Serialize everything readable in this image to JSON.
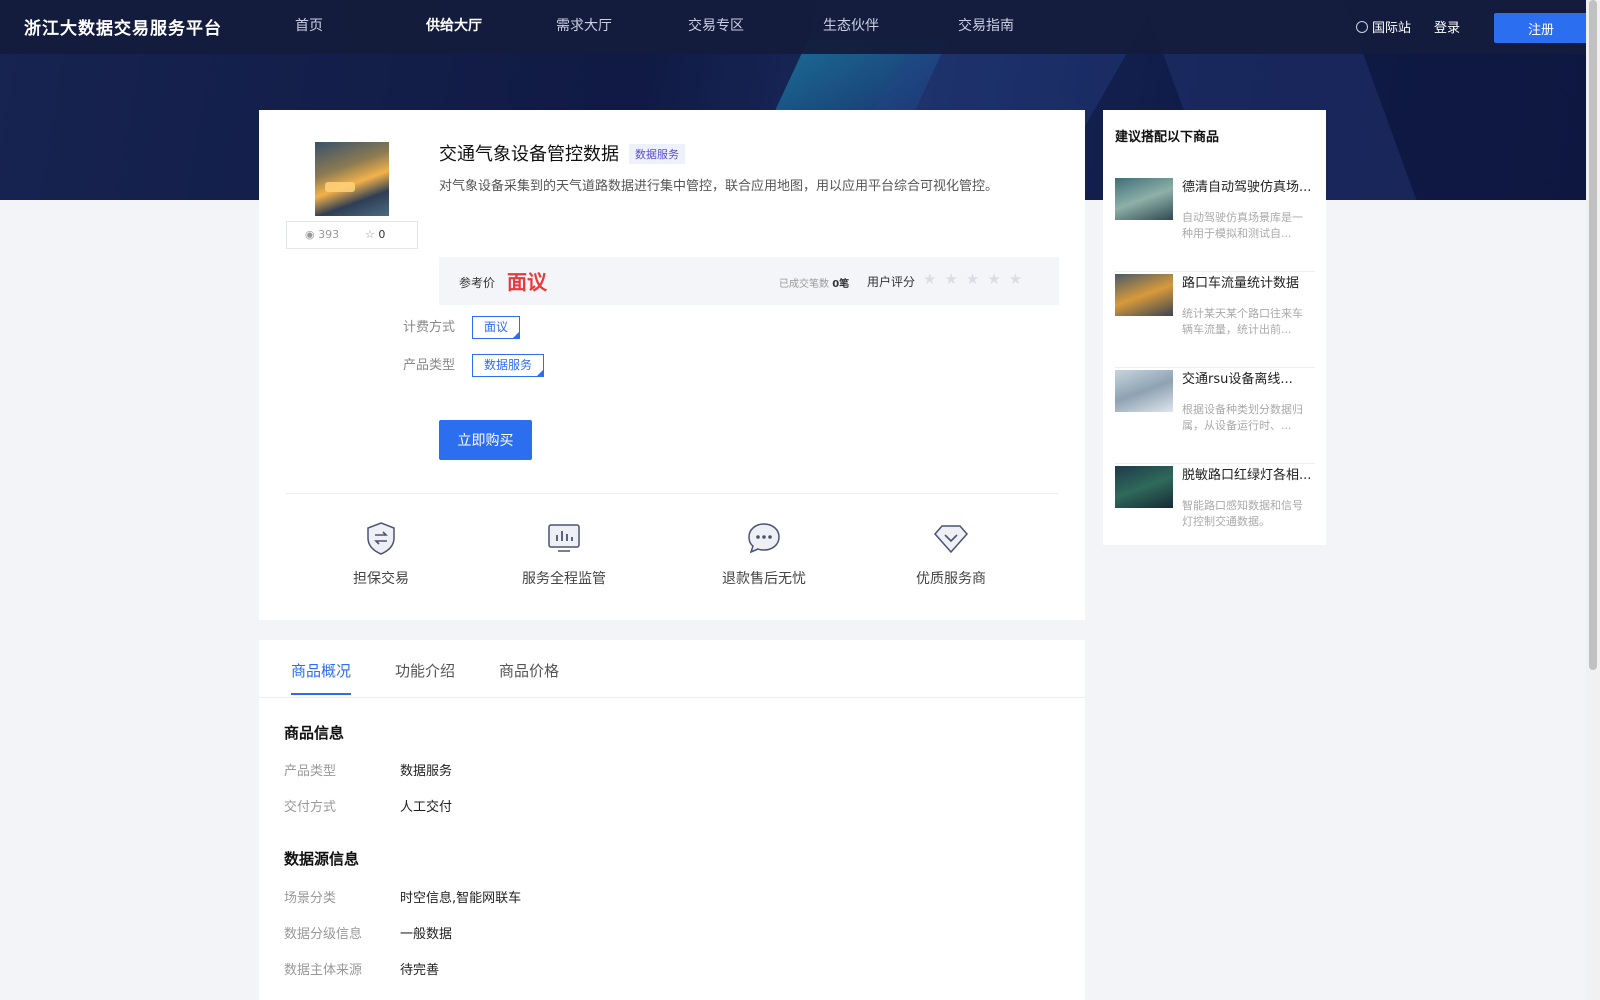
{
  "header": {
    "logo": "浙江大数据交易服务平台",
    "nav": [
      {
        "label": "首页",
        "active": false
      },
      {
        "label": "供给大厅",
        "active": true
      },
      {
        "label": "需求大厅",
        "active": false
      },
      {
        "label": "交易专区",
        "active": false
      },
      {
        "label": "生态伙伴",
        "active": false
      },
      {
        "label": "交易指南",
        "active": false
      }
    ],
    "intl_label": "国际站",
    "login_label": "登录",
    "register_label": "注册"
  },
  "product": {
    "title": "交通气象设备管控数据",
    "tag": "数据服务",
    "description": "对气象设备采集到的天气道路数据进行集中管控，联合应用地图，用以应用平台综合可视化管控。",
    "views": "393",
    "favorites": "0",
    "price_label": "参考价",
    "price": "面议",
    "deals_label": "已成交笔数",
    "deals_value": "0笔",
    "rating_label": "用户评分",
    "rating": 0,
    "billing_label": "计费方式",
    "billing_value": "面议",
    "type_label": "产品类型",
    "type_value": "数据服务",
    "buy_label": "立即购买"
  },
  "features": [
    {
      "label": "担保交易",
      "icon": "shield-exchange-icon"
    },
    {
      "label": "服务全程监管",
      "icon": "monitor-chart-icon"
    },
    {
      "label": "退款售后无忧",
      "icon": "chat-bubble-icon"
    },
    {
      "label": "优质服务商",
      "icon": "diamond-icon"
    }
  ],
  "tabs": [
    {
      "label": "商品概况",
      "active": true
    },
    {
      "label": "功能介绍",
      "active": false
    },
    {
      "label": "商品价格",
      "active": false
    }
  ],
  "details": {
    "product_info_title": "商品信息",
    "product_info": [
      {
        "key": "产品类型",
        "value": "数据服务"
      },
      {
        "key": "交付方式",
        "value": "人工交付"
      }
    ],
    "datasource_title": "数据源信息",
    "datasource_info": [
      {
        "key": "场景分类",
        "value": "时空信息,智能网联车"
      },
      {
        "key": "数据分级信息",
        "value": "一般数据"
      },
      {
        "key": "数据主体来源",
        "value": "待完善"
      }
    ]
  },
  "sidebar": {
    "title": "建议搭配以下商品",
    "items": [
      {
        "name": "德清自动驾驶仿真场...",
        "desc": "自动驾驶仿真场景库是一种用于模拟和测试自...",
        "thumb_color": "#3e6f78"
      },
      {
        "name": "路口车流量统计数据",
        "desc": "统计某天某个路口往来车辆车流量，统计出前...",
        "thumb_color": "#8a6a3a"
      },
      {
        "name": "交通rsu设备离线...",
        "desc": "根据设备种类划分数据归属，从设备运行时、...",
        "thumb_color": "#9fb3c4"
      },
      {
        "name": "脱敏路口红绿灯各相...",
        "desc": "智能路口感知数据和信号灯控制交通数据。",
        "thumb_color": "#1f3a4a"
      }
    ]
  }
}
